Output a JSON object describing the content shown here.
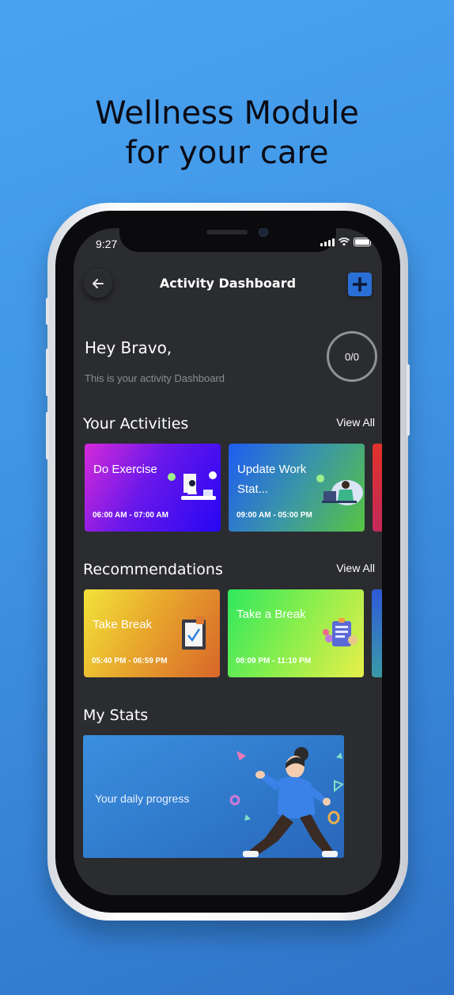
{
  "headline": {
    "line1": "Wellness Module",
    "line2": "for your care"
  },
  "status_bar": {
    "time": "9:27"
  },
  "header": {
    "title": "Activity Dashboard",
    "back_icon": "arrow-left-icon",
    "add_icon": "plus-icon"
  },
  "greeting": {
    "title": "Hey Bravo,",
    "subtitle": "This is your activity Dashboard",
    "progress": "0/0"
  },
  "activities": {
    "title": "Your Activities",
    "view_all": "View All",
    "items": [
      {
        "title": "Do Exercise",
        "time": "06:00 AM - 07:00 AM",
        "colors": [
          "#d02ad6",
          "#2a07f2"
        ]
      },
      {
        "title": "Update Work Stat...",
        "time": "09:00 AM - 05:00 PM",
        "colors": [
          "#2166f0",
          "#55c04a"
        ]
      }
    ]
  },
  "recommendations": {
    "title": "Recommendations",
    "view_all": "View All",
    "items": [
      {
        "title": "Take Break",
        "time": "05:40 PM - 06:59 PM",
        "colors": [
          "#f0e23a",
          "#dc6a24"
        ]
      },
      {
        "title": "Take a Break",
        "time": "08:09 PM - 11:10 PM",
        "colors": [
          "#2ee860",
          "#e6ef48"
        ]
      }
    ]
  },
  "stats": {
    "title": "My Stats",
    "card_label": "Your daily progress"
  }
}
